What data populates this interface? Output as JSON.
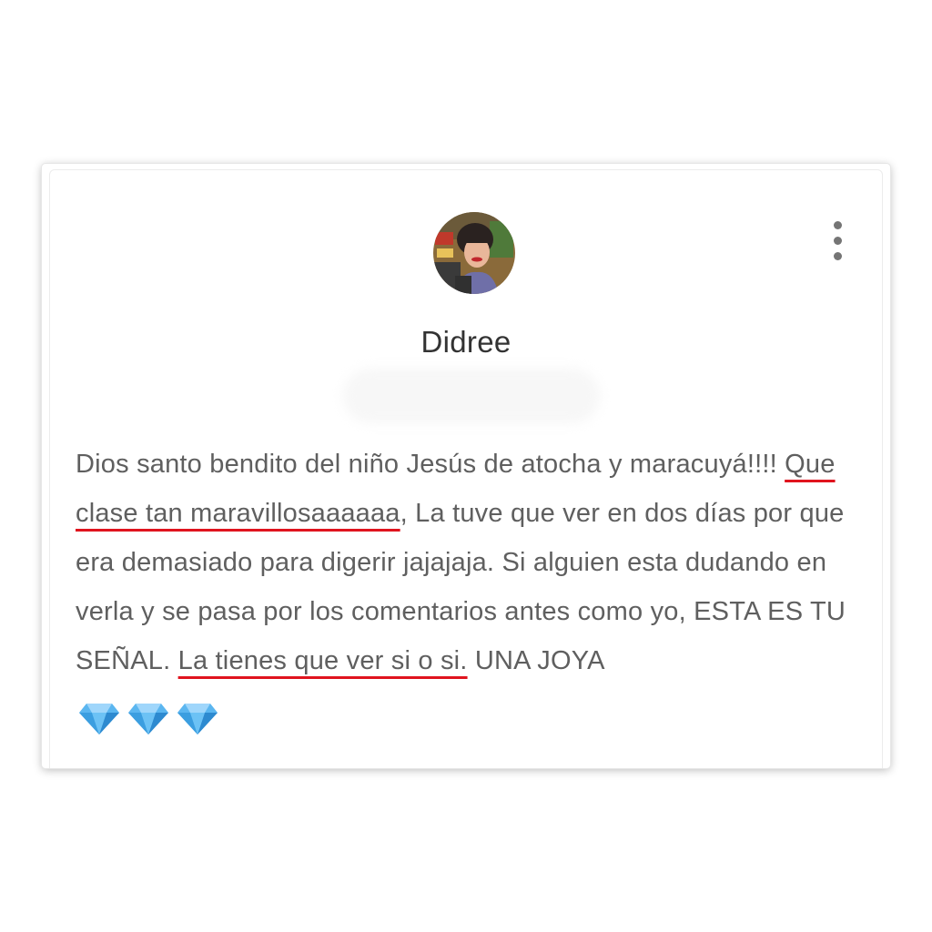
{
  "comment_card": {
    "author_name": "Didree",
    "menu_icon": "more-vert-icon",
    "body": {
      "text_part_1": "Dios santo bendito del niño Jesús de atocha y maracuyá!!!! ",
      "highlight_1": "Que clase tan maravillosaaaaaa",
      "text_part_2": ", La tuve que ver en dos días por que era demasiado para digerir jajajaja. Si alguien esta dudando en verla y se pasa por los comentarios antes como yo, ESTA ES TU SEÑAL. ",
      "highlight_2": "La tienes que ver si o si.",
      "text_part_3": " UNA JOYA"
    },
    "emojis": [
      "gem-icon",
      "gem-icon",
      "gem-icon"
    ],
    "highlight_color": "#e0141e",
    "gem_color": "#5bb6f0"
  }
}
